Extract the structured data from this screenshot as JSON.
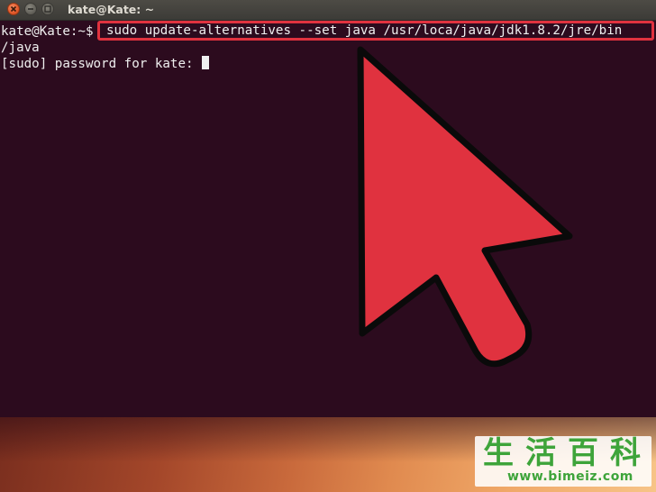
{
  "window": {
    "title": "kate@Kate: ~",
    "controls": {
      "close_icon": "close-icon",
      "minimize_icon": "minimize-icon",
      "maximize_icon": "maximize-icon"
    }
  },
  "terminal": {
    "prompt": "kate@Kate:~$",
    "command": "sudo update-alternatives --set java /usr/loca/java/jdk1.8.2/jre/bin",
    "command_continuation": "/java",
    "sudo_prompt": "[sudo] password for kate: ",
    "highlight_color": "#e0323f"
  },
  "overlay": {
    "arrow_icon": "cursor-arrow-icon",
    "arrow_color": "#e0323f"
  },
  "watermark": {
    "chars": [
      "生",
      "活",
      "百",
      "科"
    ],
    "url": "www.bimeiz.com",
    "color": "#3ea43a"
  }
}
